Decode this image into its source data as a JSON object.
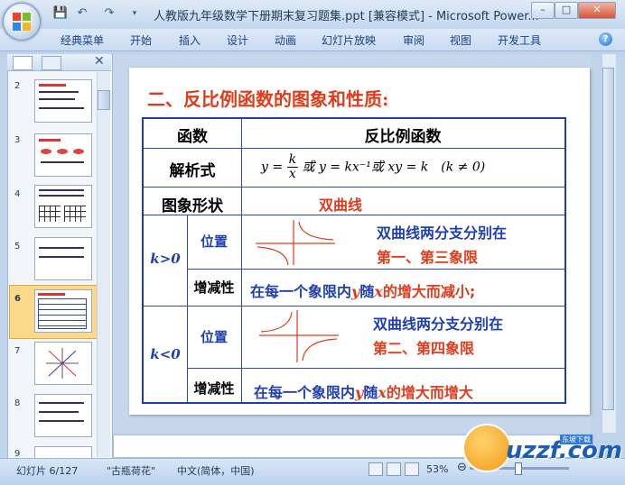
{
  "window": {
    "title": "人教版九年级数学下册期末复习题集.ppt [兼容模式] - Microsoft Power...",
    "minimize": "–",
    "maximize": "□",
    "close": "✕"
  },
  "quick_access": {
    "save": "💾",
    "undo": "↶",
    "redo": "↷"
  },
  "ribbon": {
    "tabs": [
      "经典菜单",
      "开始",
      "插入",
      "设计",
      "动画",
      "幻灯片放映",
      "审阅",
      "视图",
      "开发工具"
    ],
    "help": "?"
  },
  "thumbnails": {
    "numbers": [
      "2",
      "3",
      "4",
      "5",
      "6",
      "7",
      "8",
      "9"
    ],
    "selected": "6"
  },
  "slide": {
    "title": "二、反比例函数的图象和性质:",
    "table": {
      "header_left": "函数",
      "header_right": "反比例函数",
      "row_formula_label": "解析式",
      "formula_y": "y",
      "formula_k": "k",
      "formula_x": "x",
      "formula_rest": "或 y = kx⁻¹或 xy = k　(k ≠ 0)",
      "row_shape_label": "图象形状",
      "shape_value": "双曲线",
      "k_pos": "k>0",
      "k_neg": "k<0",
      "position_label": "位置",
      "monotonic_label": "增减性",
      "pos_position_line1": "双曲线两分支分别在",
      "pos_position_line2": "第一、第三象限",
      "pos_mono_prefix": "在每一个象限内",
      "pos_mono_y": "y",
      "pos_mono_mid": "随",
      "pos_mono_x": "x",
      "pos_mono_suffix": "的增大而减小;",
      "neg_position_line1": "双曲线两分支分别在",
      "neg_position_line2": "第二、第四象限",
      "neg_mono_prefix": "在每一个象限内",
      "neg_mono_y": "y",
      "neg_mono_mid": "随",
      "neg_mono_x": "x",
      "neg_mono_suffix": "的增大而增大"
    }
  },
  "status": {
    "slide_indicator": "幻灯片 6/127",
    "theme": "\"古瓶荷花\"",
    "language": "中文(简体，中国)",
    "zoom": "53%"
  },
  "watermark": {
    "text": "uzzf.com",
    "badge": "东坡下载"
  },
  "colors": {
    "title_red": "#e03c1c",
    "table_blue": "#1f3fa8",
    "text_blue": "#1f3fb0"
  }
}
